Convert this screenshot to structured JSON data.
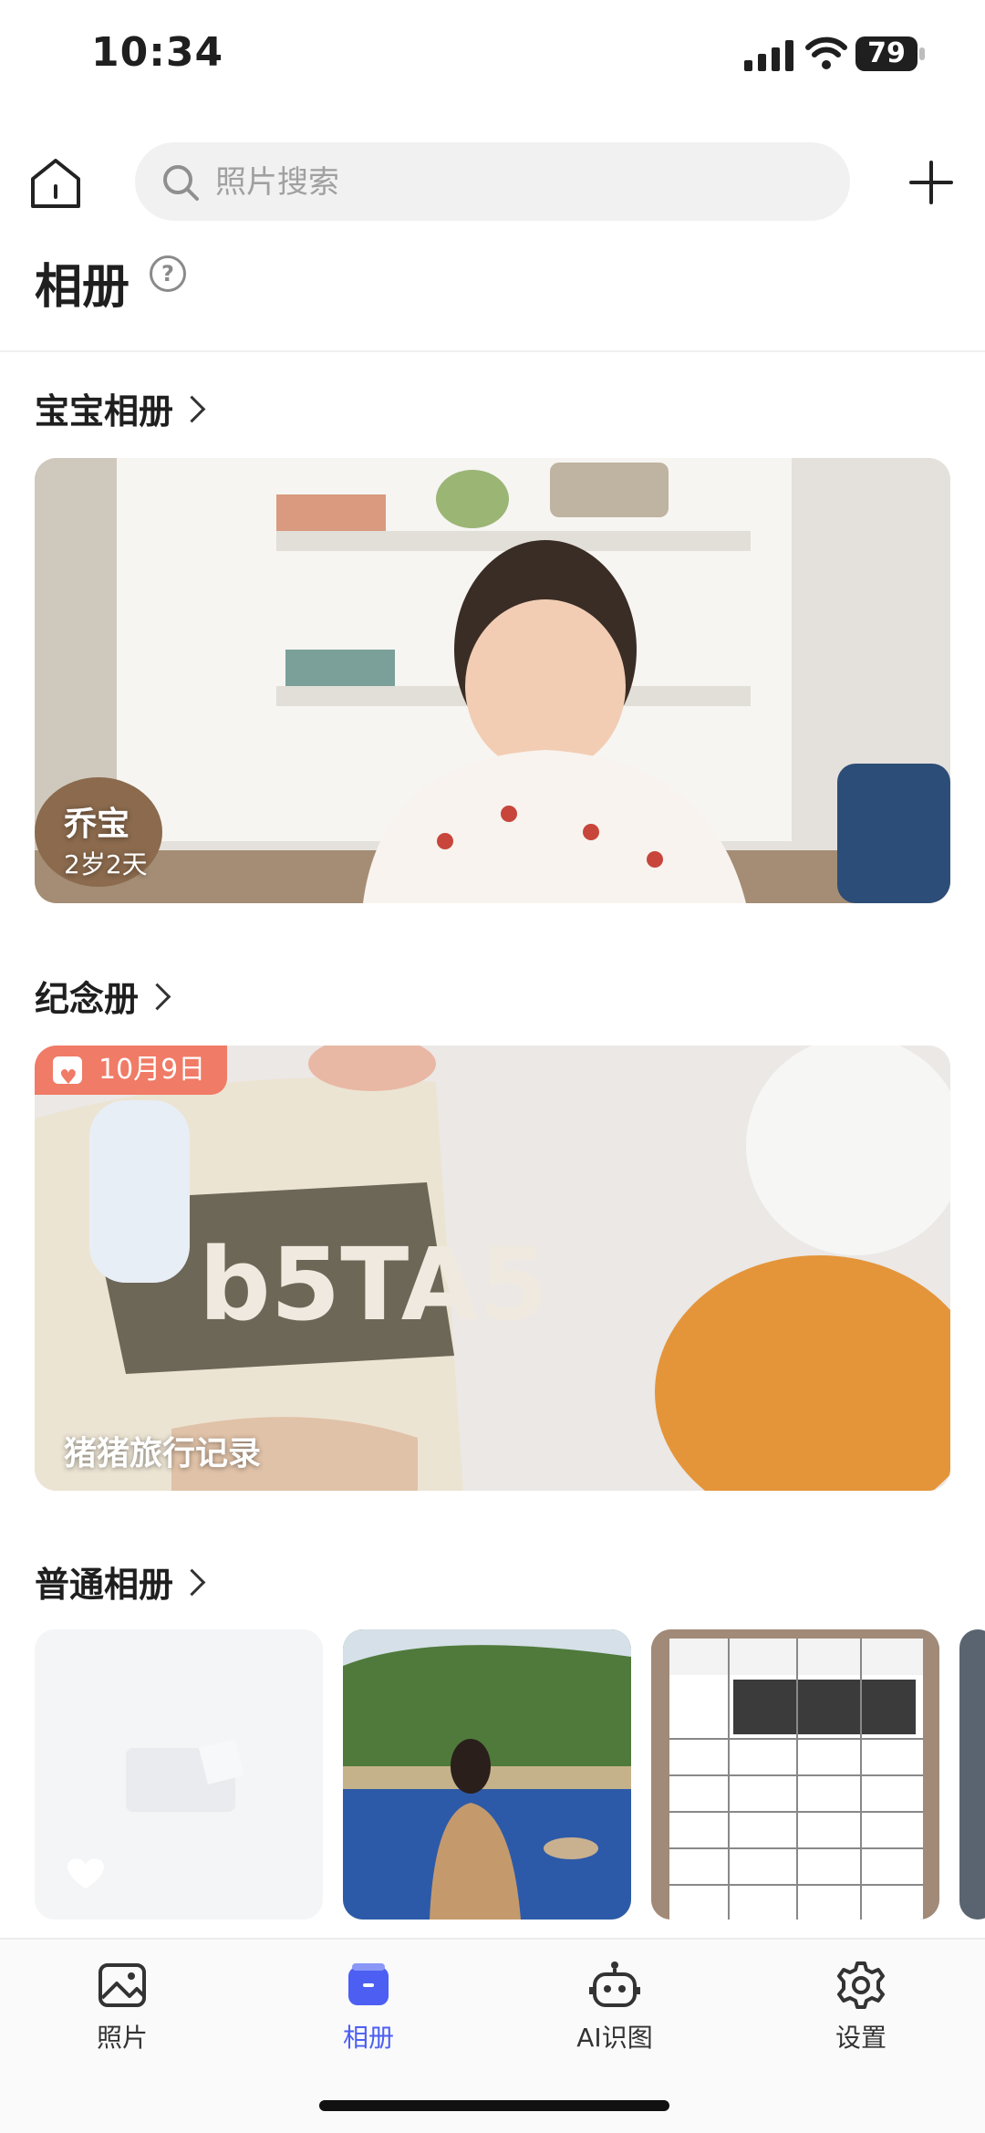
{
  "status_bar": {
    "time": "10:34",
    "battery": "79"
  },
  "header": {
    "search_placeholder": "照片搜索"
  },
  "page": {
    "title": "相册"
  },
  "sections": {
    "baby": {
      "title": "宝宝相册",
      "card": {
        "name": "乔宝",
        "age": "2岁2天"
      }
    },
    "memory": {
      "title": "纪念册",
      "card": {
        "date": "10月9日",
        "name": "猪猪旅行记录"
      }
    },
    "normal": {
      "title": "普通相册"
    }
  },
  "tabs": [
    {
      "label": "照片",
      "icon": "photo-icon"
    },
    {
      "label": "相册",
      "icon": "album-icon",
      "active": true
    },
    {
      "label": "AI识图",
      "icon": "robot-icon"
    },
    {
      "label": "设置",
      "icon": "gear-icon"
    }
  ],
  "colors": {
    "accent": "#4c5ff2",
    "badge": "#f07b66"
  }
}
